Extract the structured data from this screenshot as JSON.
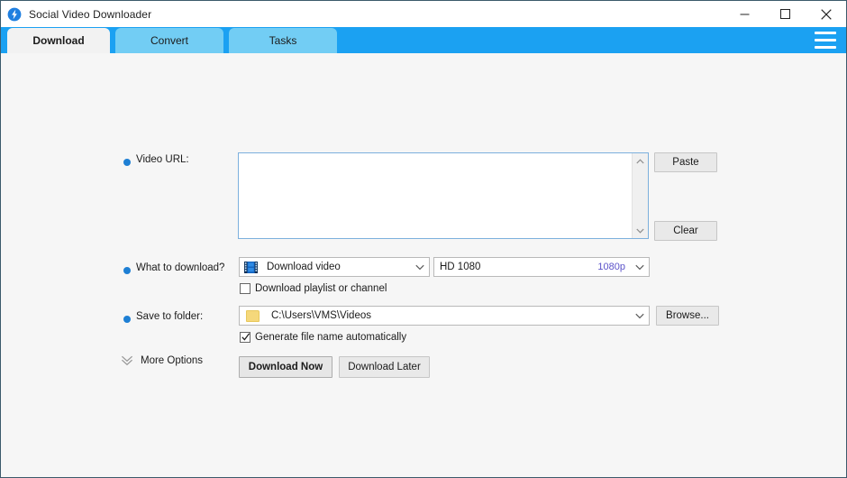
{
  "window": {
    "title": "Social Video Downloader",
    "app_icon": "lightning-bolt-icon",
    "controls": {
      "minimize": "minimize-icon",
      "maximize": "maximize-icon",
      "close": "close-icon"
    }
  },
  "tabs": [
    {
      "label": "Download",
      "active": true
    },
    {
      "label": "Convert",
      "active": false
    },
    {
      "label": "Tasks",
      "active": false
    }
  ],
  "menu": {
    "icon": "hamburger-menu-icon"
  },
  "form": {
    "url": {
      "label": "Video URL:",
      "value": "",
      "placeholder": ""
    },
    "buttons": {
      "paste": "Paste",
      "clear": "Clear",
      "browse": "Browse...",
      "download_now": "Download Now",
      "download_later": "Download Later"
    },
    "what_to_download": {
      "label": "What to download?",
      "selected": "Download video",
      "icon": "film-strip-icon"
    },
    "quality": {
      "selected": "HD 1080",
      "badge": "1080p"
    },
    "playlist_checkbox": {
      "label": "Download playlist or channel",
      "checked": false
    },
    "save_to_folder": {
      "label": "Save to folder:",
      "path": "C:\\Users\\VMS\\Videos",
      "icon": "folder-icon"
    },
    "generate_name_checkbox": {
      "label": "Generate file name automatically",
      "checked": true
    },
    "more_options": {
      "label": "More Options",
      "icon": "double-chevron-down-icon"
    }
  },
  "colors": {
    "accent": "#1ba1f2",
    "tab_inactive": "#72cdf4",
    "bullet": "#1e7fd4",
    "quality_badge": "#5b52c9",
    "folder": "#f5d87b"
  }
}
